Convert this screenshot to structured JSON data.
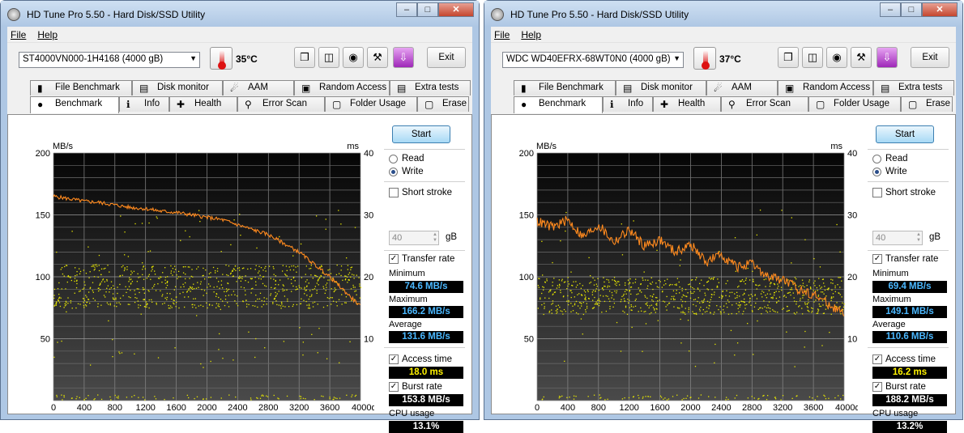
{
  "windows": [
    {
      "title": "HD Tune Pro 5.50 - Hard Disk/SSD Utility",
      "menu": [
        "File",
        "Help"
      ],
      "drive": "ST4000VN000-1H4168 (4000 gB)",
      "temperature": "35°C",
      "exit_label": "Exit",
      "tabs_top": [
        "File Benchmark",
        "Disk monitor",
        "AAM",
        "Random Access",
        "Extra tests"
      ],
      "tabs_bottom": [
        "Benchmark",
        "Info",
        "Health",
        "Error Scan",
        "Folder Usage",
        "Erase"
      ],
      "start_label": "Start",
      "read_label": "Read",
      "write_label": "Write",
      "mode_selected": "Write",
      "short_stroke_label": "Short stroke",
      "short_stroke_value": "40",
      "short_stroke_unit": "gB",
      "transfer_rate_label": "Transfer rate",
      "minimum_label": "Minimum",
      "minimum": "74.6 MB/s",
      "maximum_label": "Maximum",
      "maximum": "166.2 MB/s",
      "average_label": "Average",
      "average": "131.6 MB/s",
      "access_time_label": "Access time",
      "access_time": "18.0 ms",
      "burst_rate_label": "Burst rate",
      "burst_rate": "153.8 MB/s",
      "cpu_label": "CPU usage",
      "cpu": "13.1%",
      "chart_data": {
        "type": "line",
        "y_left_label": "MB/s",
        "y_right_label": "ms",
        "x_unit": "gB",
        "xlim": [
          0,
          4000
        ],
        "ylim_left": [
          0,
          200
        ],
        "ylim_right": [
          0,
          40
        ],
        "x_ticks": [
          0,
          400,
          800,
          1200,
          1600,
          2000,
          2400,
          2800,
          3200,
          3600,
          4000
        ],
        "y_left_ticks": [
          50,
          100,
          150,
          200
        ],
        "y_right_ticks": [
          10,
          20,
          30,
          40
        ],
        "grid": true,
        "series": [
          {
            "kind": "transfer",
            "color": "#ff8a1e",
            "x": [
              0,
              200,
              400,
              600,
              800,
              1000,
              1200,
              1400,
              1600,
              1800,
              2000,
              2200,
              2400,
              2600,
              2800,
              3000,
              3200,
              3400,
              3600,
              3800,
              4000
            ],
            "y": [
              165,
              163,
              161,
              160,
              158,
              156,
              155,
              153,
              152,
              150,
              148,
              146,
              142,
              138,
              134,
              127,
              120,
              110,
              100,
              88,
              76
            ]
          },
          {
            "kind": "access",
            "color": "#e8e800",
            "y_band": [
              15,
              22
            ]
          }
        ]
      }
    },
    {
      "title": "HD Tune Pro 5.50 - Hard Disk/SSD Utility",
      "menu": [
        "File",
        "Help"
      ],
      "drive": "WDC WD40EFRX-68WT0N0 (4000 gB)",
      "temperature": "37°C",
      "exit_label": "Exit",
      "tabs_top": [
        "File Benchmark",
        "Disk monitor",
        "AAM",
        "Random Access",
        "Extra tests"
      ],
      "tabs_bottom": [
        "Benchmark",
        "Info",
        "Health",
        "Error Scan",
        "Folder Usage",
        "Erase"
      ],
      "start_label": "Start",
      "read_label": "Read",
      "write_label": "Write",
      "mode_selected": "Write",
      "short_stroke_label": "Short stroke",
      "short_stroke_value": "40",
      "short_stroke_unit": "gB",
      "transfer_rate_label": "Transfer rate",
      "minimum_label": "Minimum",
      "minimum": "69.4 MB/s",
      "maximum_label": "Maximum",
      "maximum": "149.1 MB/s",
      "average_label": "Average",
      "average": "110.6 MB/s",
      "access_time_label": "Access time",
      "access_time": "16.2 ms",
      "burst_rate_label": "Burst rate",
      "burst_rate": "188.2 MB/s",
      "cpu_label": "CPU usage",
      "cpu": "13.2%",
      "chart_data": {
        "type": "line",
        "y_left_label": "MB/s",
        "y_right_label": "ms",
        "x_unit": "gB",
        "xlim": [
          0,
          4000
        ],
        "ylim_left": [
          0,
          200
        ],
        "ylim_right": [
          0,
          40
        ],
        "x_ticks": [
          0,
          400,
          800,
          1200,
          1600,
          2000,
          2400,
          2800,
          3200,
          3600,
          4000
        ],
        "y_left_ticks": [
          50,
          100,
          150,
          200
        ],
        "y_right_ticks": [
          10,
          20,
          30,
          40
        ],
        "grid": true,
        "series": [
          {
            "kind": "transfer",
            "color": "#ff8a1e",
            "x": [
              0,
              200,
              400,
              600,
              800,
              1000,
              1200,
              1400,
              1600,
              1800,
              2000,
              2200,
              2400,
              2600,
              2800,
              3000,
              3200,
              3400,
              3600,
              3800,
              4000
            ],
            "y": [
              145,
              140,
              146,
              132,
              142,
              128,
              138,
              125,
              130,
              120,
              126,
              112,
              118,
              108,
              110,
              100,
              98,
              90,
              86,
              78,
              70
            ]
          },
          {
            "kind": "access",
            "color": "#e8e800",
            "y_band": [
              14,
              20
            ]
          }
        ]
      }
    }
  ]
}
